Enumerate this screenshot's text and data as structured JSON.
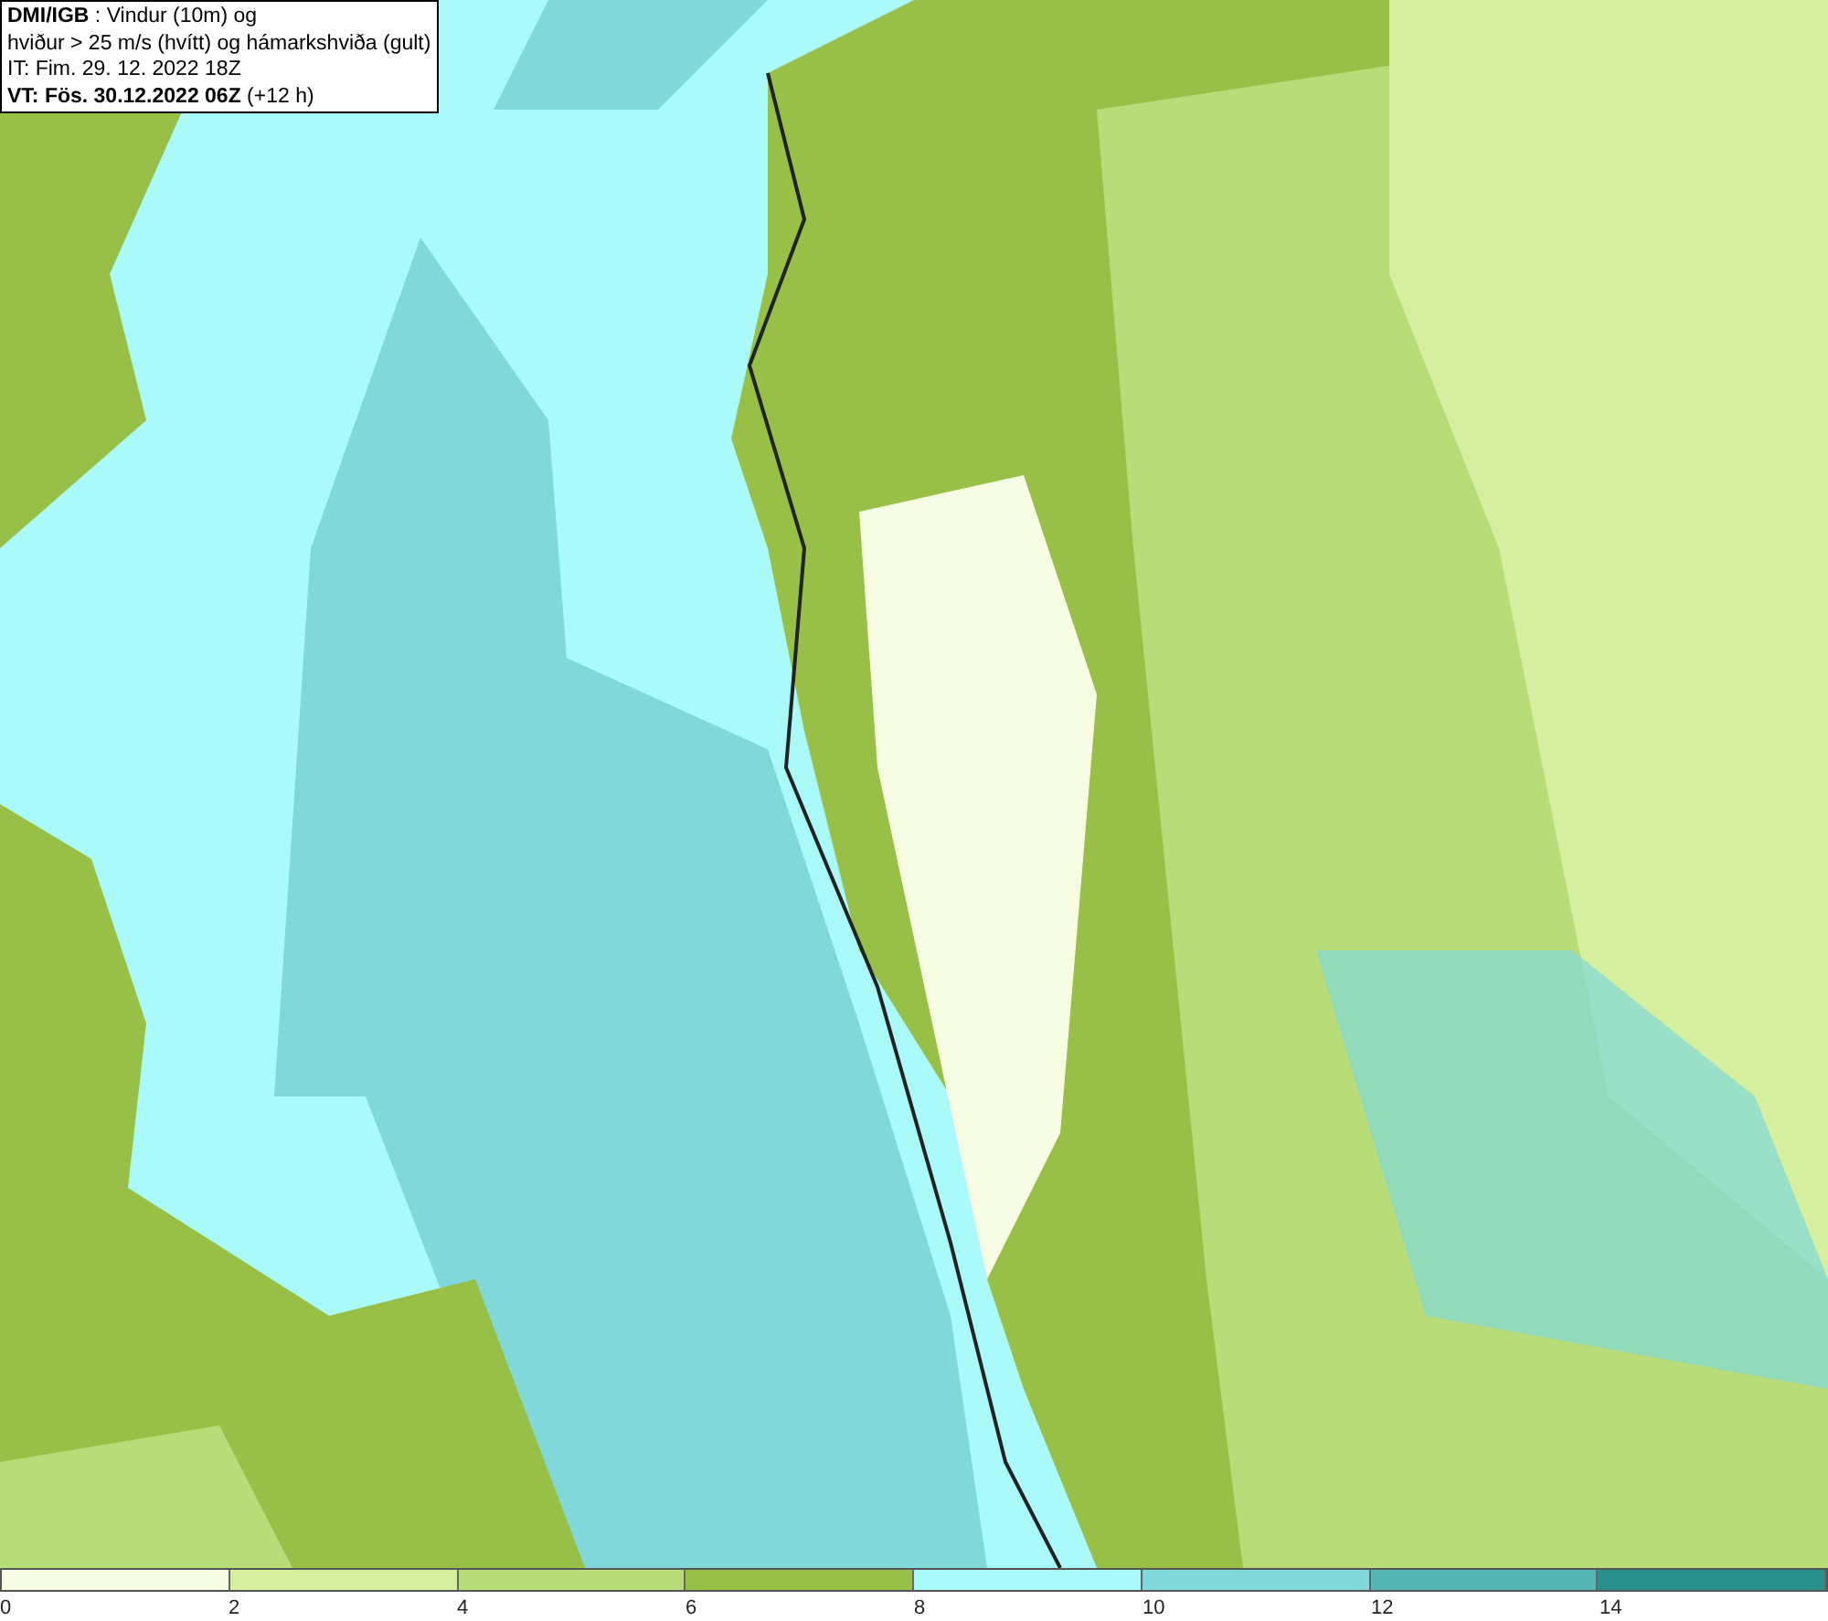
{
  "header": [
    "**DMI/IGB** : Vindur (10m) og",
    "hviður > 25 m/s (hvítt) og hámarkshviða (gult)",
    "IT: Fim. 29. 12. 2022 18Z",
    "**VT: Fös. 30.12.2022 06Z** (+12 h)"
  ],
  "legend": {
    "bins": [
      {
        "color": "#f6fde2"
      },
      {
        "color": "#d6ef9e"
      },
      {
        "color": "#b8dc78"
      },
      {
        "color": "#98c046"
      },
      {
        "color": "#aafafa"
      },
      {
        "color": "#80d8d8"
      },
      {
        "color": "#56b6b4"
      },
      {
        "color": "#2a908c"
      }
    ],
    "ticks": [
      "0",
      "2",
      "4",
      "6",
      "8",
      "10",
      "12",
      "14"
    ]
  }
}
